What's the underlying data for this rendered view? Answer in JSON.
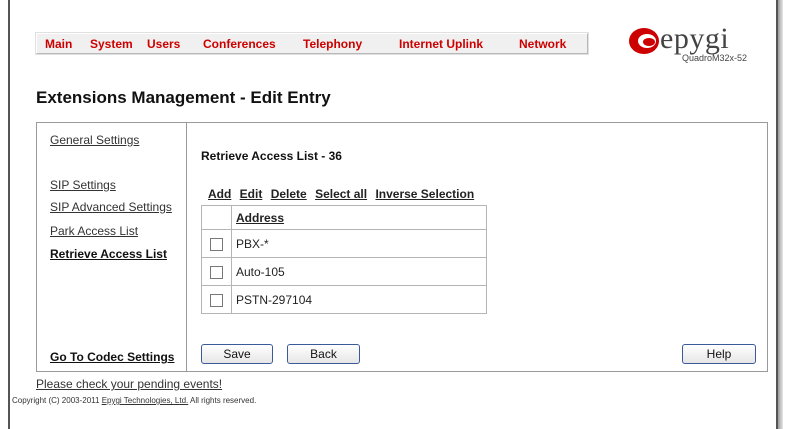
{
  "topnav": {
    "items": [
      "Main",
      "System",
      "Users",
      "Conferences",
      "Telephony",
      "Internet Uplink",
      "Network"
    ]
  },
  "logo": {
    "brand": "epygi",
    "model": "QuadroM32x-52",
    "accent_color": "#cc0000"
  },
  "page": {
    "title": "Extensions Management - Edit Entry"
  },
  "sidebar": {
    "items": [
      "General Settings",
      "SIP Settings",
      "SIP Advanced Settings",
      "Park Access List",
      "Retrieve Access List"
    ],
    "active": "Retrieve Access List",
    "bottom_link": "Go To Codec Settings"
  },
  "main": {
    "section_title": "Retrieve Access List - 36",
    "toolbar": [
      "Add",
      "Edit",
      "Delete",
      "Select all",
      "Inverse Selection"
    ],
    "table": {
      "column_header": "Address",
      "rows": [
        "PBX-*",
        "Auto-105",
        "PSTN-297104"
      ]
    },
    "buttons": {
      "save": "Save",
      "back": "Back",
      "help": "Help"
    }
  },
  "footer": {
    "pending_events": "Please check your pending events!",
    "copyright_prefix": "Copyright (C) 2003-2011",
    "copyright_company": "Epygi Technologies, Ltd.",
    "copyright_suffix": "All rights reserved."
  }
}
